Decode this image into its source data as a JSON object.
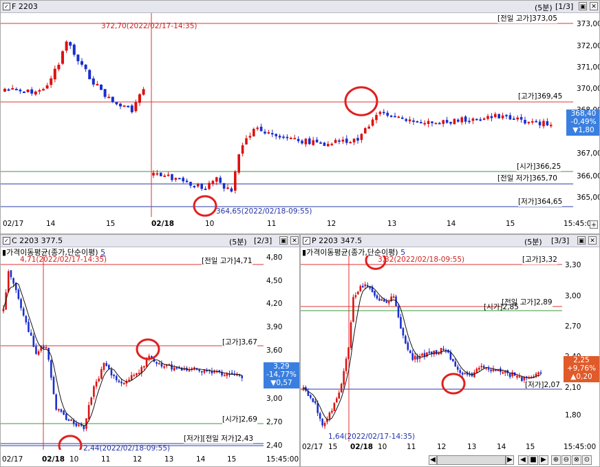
{
  "panels": {
    "p1": {
      "title": "F 2203",
      "period": "(5분)",
      "page": "[1/3]",
      "yticks": [
        "373,00",
        "372,00",
        "371,00",
        "370,00",
        "368,00",
        "367,00",
        "366,00",
        "365,00"
      ],
      "xticks": [
        "02/17",
        "14",
        "15",
        "02/18",
        "10",
        "11",
        "12",
        "13",
        "14",
        "15",
        "15:45:00"
      ],
      "tags": {
        "prev_high": "[전일 고가]373,05",
        "high": "[고가]369,45",
        "open": "[시가]366,25",
        "prev_low": "[전일 저가]365,70",
        "low": "[저가]364,65"
      },
      "ann_high": "372,70(2022/02/17-14:35)",
      "ann_low": "364,65(2022/02/18-09:55)",
      "badge": {
        "price": "368,40",
        "pct": "-0,49%",
        "chg": "▼1,80",
        "color": "#3a7fe0"
      }
    },
    "p2": {
      "title": "C 2203 377.5",
      "period": "(5분)",
      "page": "[2/3]",
      "indicator": "가격이동평균(종가,단순이평)",
      "indicator_param": "5",
      "yticks": [
        "4,80",
        "4,50",
        "4,20",
        "3,90",
        "3,60",
        "3,00",
        "2,70",
        "2,40"
      ],
      "xticks": [
        "02/17",
        "02/18",
        "10",
        "11",
        "12",
        "13",
        "14",
        "15",
        "15:45:00"
      ],
      "tags": {
        "prev_high": "[전일 고가]4,71",
        "high": "[고가]3,67",
        "open": "[시가]2,69",
        "prev_low": "[저가][전일 저가]2,43"
      },
      "ann_high": "4,71(2022/02/17-14:35)",
      "ann_low": "2,44(2022/02/18-09:55)",
      "badge": {
        "price": "3,29",
        "pct": "-14,77%",
        "chg": "▼0,57",
        "color": "#3a7fe0"
      }
    },
    "p3": {
      "title": "P 2203 347.5",
      "period": "(5분)",
      "page": "[3/3]",
      "indicator": "가격이동평균(종가,단순이평)",
      "indicator_param": "5",
      "yticks": [
        "3,30",
        "3,00",
        "2,70",
        "2,40",
        "2,10",
        "1,80"
      ],
      "xticks": [
        "02/17",
        "15",
        "02/18",
        "10",
        "11",
        "12",
        "13",
        "14",
        "15",
        "15:45:00"
      ],
      "tags": {
        "high": "[고가]3,32",
        "prev_high": "[전일 고가]2,89",
        "open": "[시가]2,85",
        "low": "[저가]2,07"
      },
      "ann_high": "3,32(2022/02/18-09:55)",
      "ann_low": "1,64(2022/02/17-14:35)",
      "badge": {
        "price": "2,25",
        "pct": "+9,76%",
        "chg": "▲0,20",
        "color": "#e05a2a"
      }
    }
  },
  "colors": {
    "up": "#dd1111",
    "down": "#1a2ed0",
    "ma": "#111111",
    "highline": "#dd3333",
    "lowline": "#2a3aa8",
    "openline": "#3a9a3a",
    "circle": "#e02020"
  }
}
